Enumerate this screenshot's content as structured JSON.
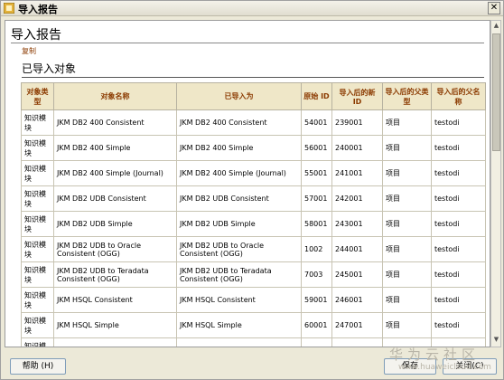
{
  "window": {
    "title": "导入报告"
  },
  "header": {
    "title": "导入报告",
    "copy_link": "复制",
    "section_title": "已导入对象"
  },
  "table": {
    "columns": [
      "对象类型",
      "对象名称",
      "已导入为",
      "原始 ID",
      "导入后的新 ID",
      "导入后的父类型",
      "导入后的父名称"
    ],
    "rows": [
      [
        "知识模块",
        "JKM DB2 400 Consistent",
        "JKM DB2 400 Consistent",
        "54001",
        "239001",
        "项目",
        "testodi"
      ],
      [
        "知识模块",
        "JKM DB2 400 Simple",
        "JKM DB2 400 Simple",
        "56001",
        "240001",
        "项目",
        "testodi"
      ],
      [
        "知识模块",
        "JKM DB2 400 Simple (Journal)",
        "JKM DB2 400 Simple (Journal)",
        "55001",
        "241001",
        "项目",
        "testodi"
      ],
      [
        "知识模块",
        "JKM DB2 UDB Consistent",
        "JKM DB2 UDB Consistent",
        "57001",
        "242001",
        "项目",
        "testodi"
      ],
      [
        "知识模块",
        "JKM DB2 UDB Simple",
        "JKM DB2 UDB Simple",
        "58001",
        "243001",
        "项目",
        "testodi"
      ],
      [
        "知识模块",
        "JKM DB2 UDB to Oracle Consistent (OGG)",
        "JKM DB2 UDB to Oracle Consistent (OGG)",
        "1002",
        "244001",
        "项目",
        "testodi"
      ],
      [
        "知识模块",
        "JKM DB2 UDB to Teradata Consistent (OGG)",
        "JKM DB2 UDB to Teradata Consistent (OGG)",
        "7003",
        "245001",
        "项目",
        "testodi"
      ],
      [
        "知识模块",
        "JKM HSQL Consistent",
        "JKM HSQL Consistent",
        "59001",
        "246001",
        "项目",
        "testodi"
      ],
      [
        "知识模块",
        "JKM HSQL Simple",
        "JKM HSQL Simple",
        "60001",
        "247001",
        "项目",
        "testodi"
      ],
      [
        "知识模块",
        "",
        "",
        "",
        "",
        "",
        ""
      ]
    ]
  },
  "buttons": {
    "help": "帮助 (H)",
    "save": "保存",
    "close": "关闭(C)"
  },
  "watermark": {
    "text": "华为云社区",
    "url": "www.huaweicloud.com"
  }
}
